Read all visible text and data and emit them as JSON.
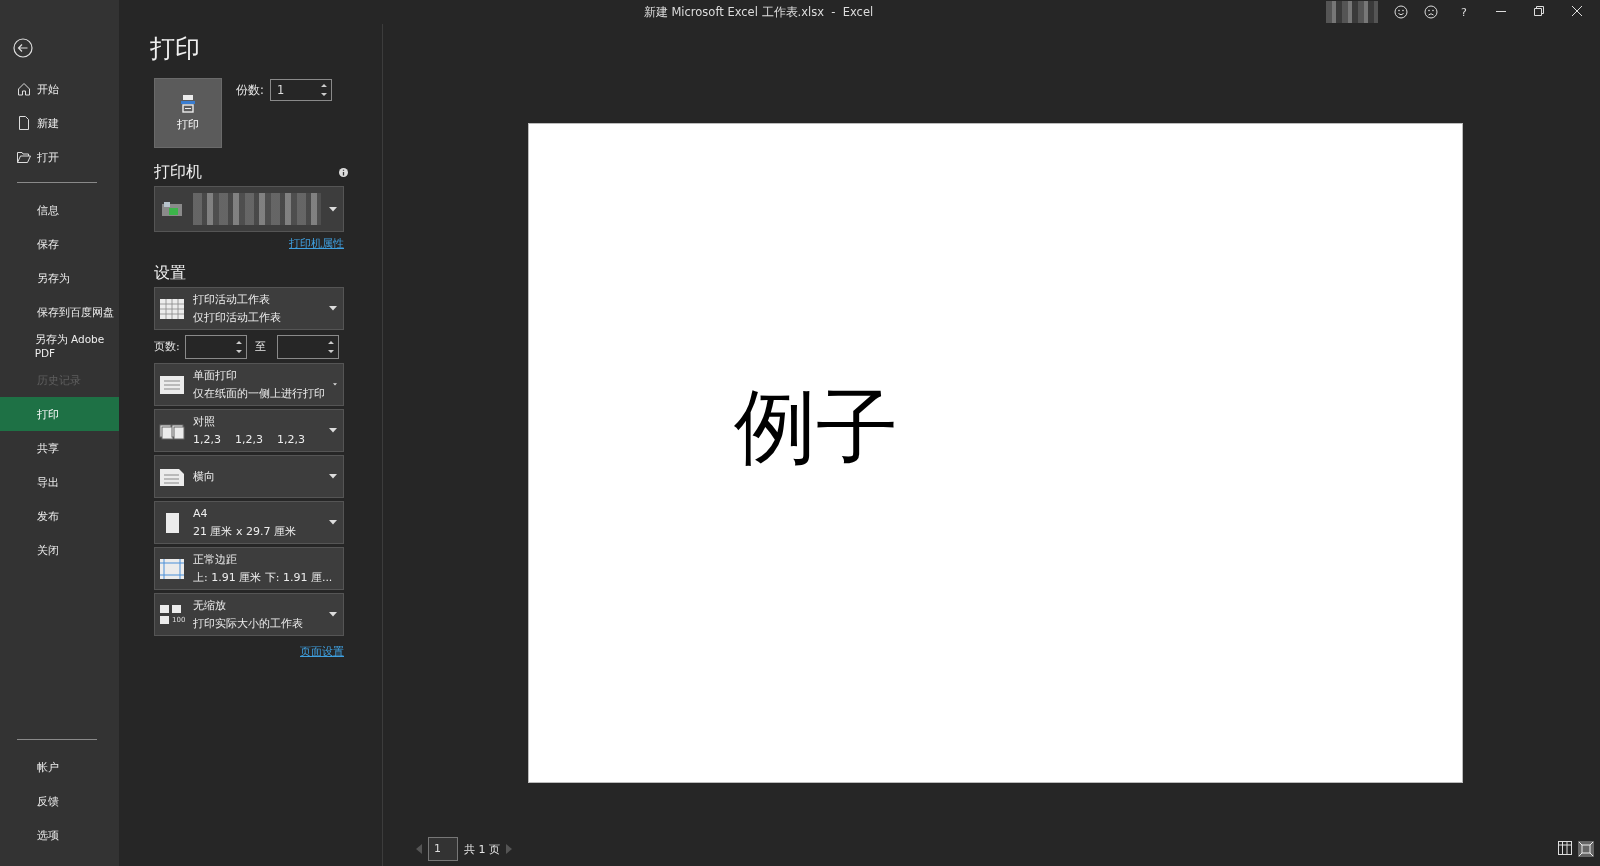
{
  "window": {
    "title": "新建 Microsoft Excel 工作表.xlsx  -  Excel",
    "help": "?"
  },
  "sidebar": {
    "top_items": [
      {
        "label": "开始",
        "kind": "home",
        "selected": false,
        "disabled": false
      },
      {
        "label": "新建",
        "kind": "page",
        "selected": false,
        "disabled": false
      },
      {
        "label": "打开",
        "kind": "folder",
        "selected": false,
        "disabled": false
      }
    ],
    "items": [
      {
        "label": "信息",
        "selected": false,
        "disabled": false
      },
      {
        "label": "保存",
        "selected": false,
        "disabled": false
      },
      {
        "label": "另存为",
        "selected": false,
        "disabled": false
      },
      {
        "label": "保存到百度网盘",
        "selected": false,
        "disabled": false
      },
      {
        "label": "另存为 Adobe PDF",
        "selected": false,
        "disabled": false
      },
      {
        "label": "历史记录",
        "selected": false,
        "disabled": true
      },
      {
        "label": "打印",
        "selected": true,
        "disabled": false
      },
      {
        "label": "共享",
        "selected": false,
        "disabled": false
      },
      {
        "label": "导出",
        "selected": false,
        "disabled": false
      },
      {
        "label": "发布",
        "selected": false,
        "disabled": false
      },
      {
        "label": "关闭",
        "selected": false,
        "disabled": false
      }
    ],
    "bottom_items": [
      {
        "label": "帐户",
        "selected": false,
        "disabled": false
      },
      {
        "label": "反馈",
        "selected": false,
        "disabled": false
      },
      {
        "label": "选项",
        "selected": false,
        "disabled": false
      }
    ]
  },
  "print": {
    "title": "打印",
    "button": "打印",
    "copies_label": "份数:",
    "copies": "1",
    "printer_heading": "打印机",
    "printer_link": "打印机属性",
    "settings_heading": "设置",
    "settings": [
      {
        "kind": "sheet",
        "title": "打印活动工作表",
        "subtitle": "仅打印活动工作表"
      },
      {
        "kind": "range",
        "label": "页数:",
        "to": "至"
      },
      {
        "kind": "single",
        "title": "单面打印",
        "subtitle": "仅在纸面的一侧上进行打印"
      },
      {
        "kind": "collate",
        "title": "对照",
        "subtitle": "1,2,3    1,2,3    1,2,3"
      },
      {
        "kind": "landscape",
        "title": "横向"
      },
      {
        "kind": "paper",
        "title": "A4",
        "subtitle": "21 厘米 x 29.7 厘米"
      },
      {
        "kind": "margins",
        "title": "正常边距",
        "subtitle": "上: 1.91 厘米 下: 1.91 厘..."
      },
      {
        "kind": "scale",
        "title": "无缩放",
        "subtitle": "打印实际大小的工作表",
        "icon_text": "100"
      }
    ],
    "page_setup_link": "页面设置"
  },
  "preview": {
    "text": "例子"
  },
  "pager": {
    "page": "1",
    "total": "共 1 页"
  }
}
